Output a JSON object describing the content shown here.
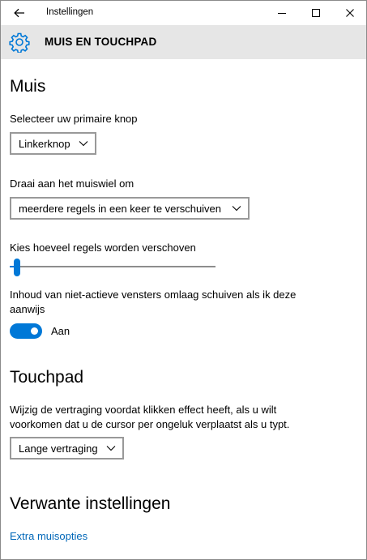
{
  "window": {
    "title": "Instellingen",
    "back_icon": "arrow-left-icon",
    "controls": {
      "minimize_icon": "minimize-icon",
      "maximize_icon": "maximize-icon",
      "close_icon": "close-icon"
    }
  },
  "header": {
    "icon": "gear-icon",
    "title": "MUIS EN TOUCHPAD"
  },
  "muis": {
    "heading": "Muis",
    "primary_button": {
      "label": "Selecteer uw primaire knop",
      "value": "Linkerknop"
    },
    "wheel": {
      "label": "Draai aan het muiswiel om",
      "value": "meerdere regels in een keer te verschuiven"
    },
    "lines": {
      "label": "Kies hoeveel regels worden verschoven",
      "slider_fraction": 0.02
    },
    "inactive_scroll": {
      "label_line1": "Inhoud van niet-actieve vensters omlaag schuiven als ik deze",
      "label_line2": "aanwijs",
      "toggle_state": "Aan",
      "on": true
    }
  },
  "touchpad": {
    "heading": "Touchpad",
    "description_line1": "Wijzig de vertraging voordat klikken effect heeft, als u wilt",
    "description_line2": "voorkomen dat u de cursor per ongeluk verplaatst als u typt.",
    "delay_value": "Lange vertraging"
  },
  "related": {
    "heading": "Verwante instellingen",
    "link": "Extra muisopties"
  },
  "colors": {
    "accent": "#0078d7",
    "link": "#0067b8",
    "header_bg": "#e6e6e6"
  }
}
